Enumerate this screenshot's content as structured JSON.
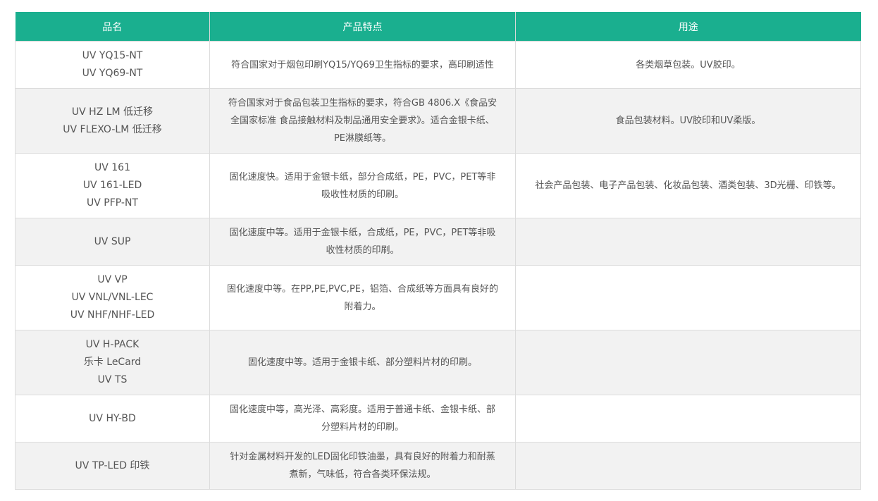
{
  "table": {
    "headers": [
      "品名",
      "产品特点",
      "用途"
    ],
    "rows": [
      {
        "names": [
          "UV YQ15-NT",
          "UV YQ69-NT"
        ],
        "feature": [
          "符合国家对于烟包印刷YQ15/YQ69卫生指标的要求，高印刷适性"
        ],
        "use": "各类烟草包装。UV胶印。"
      },
      {
        "names": [
          "UV HZ LM 低迁移",
          "UV FLEXO-LM 低迁移"
        ],
        "feature": [
          "符合国家对于食品包装卫生指标的要求，符合GB 4806.X《食品安",
          "全国家标准 食品接触材料及制品通用安全要求》。适合金银卡纸、",
          "PE淋膜纸等。"
        ],
        "use": "食品包装材料。UV胶印和UV柔版。"
      },
      {
        "names": [
          "UV 161",
          "UV 161-LED",
          "UV PFP-NT"
        ],
        "feature": [
          "固化速度快。适用于金银卡纸，部分合成纸，PE，PVC，PET等非",
          "吸收性材质的印刷。"
        ],
        "use": "社会产品包装、电子产品包装、化妆品包装、酒类包装、3D光栅、印铁等。"
      },
      {
        "names": [
          "UV SUP"
        ],
        "feature": [
          "固化速度中等。适用于金银卡纸，合成纸，PE，PVC，PET等非吸",
          "收性材质的印刷。"
        ],
        "use": ""
      },
      {
        "names": [
          "UV VP",
          "UV VNL/VNL-LEC",
          "UV NHF/NHF-LED"
        ],
        "feature": [
          "固化速度中等。在PP,PE,PVC,PE，铝箔、合成纸等方面具有良好的",
          "附着力。"
        ],
        "use": ""
      },
      {
        "names": [
          "UV H-PACK",
          "乐卡 LeCard",
          "UV TS"
        ],
        "feature": [
          "固化速度中等。适用于金银卡纸、部分塑料片材的印刷。"
        ],
        "use": ""
      },
      {
        "names": [
          "UV HY-BD"
        ],
        "feature": [
          "固化速度中等，高光泽、高彩度。适用于普通卡纸、金银卡纸、部",
          "分塑料片材的印刷。"
        ],
        "use": ""
      },
      {
        "names": [
          "UV TP-LED 印铁"
        ],
        "feature": [
          "针对金属材料开发的LED固化印铁油墨，具有良好的附着力和耐蒸",
          "煮新，气味低，符合各类环保法规。"
        ],
        "use": ""
      }
    ]
  },
  "colors": {
    "header_bg": "#1aaf8f",
    "header_text": "#ffffff",
    "row_alt_bg": "#f2f2f2",
    "border": "#dcdcdc",
    "text": "#555555"
  }
}
